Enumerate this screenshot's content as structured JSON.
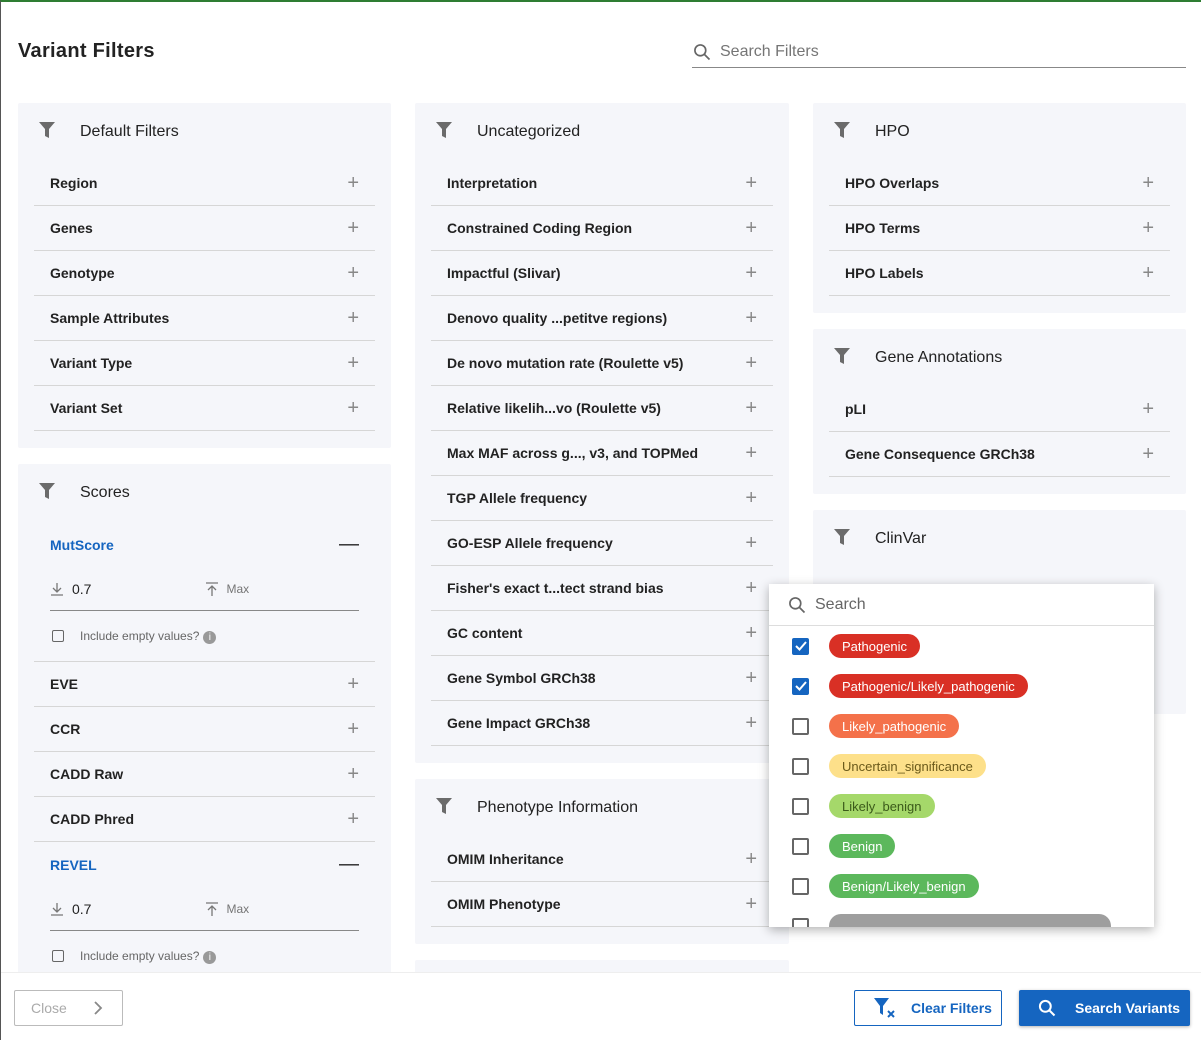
{
  "title": "Variant Filters",
  "search": {
    "placeholder": "Search Filters"
  },
  "colors": {
    "accent": "#1565c0",
    "panel_bg": "#f5f6fa",
    "top_border": "#2e7d32"
  },
  "panels": [
    {
      "title": "Default Filters",
      "rows": [
        {
          "label": "Region"
        },
        {
          "label": "Genes"
        },
        {
          "label": "Genotype"
        },
        {
          "label": "Sample Attributes"
        },
        {
          "label": "Variant Type"
        },
        {
          "label": "Variant Set"
        }
      ]
    },
    {
      "title": "Scores",
      "rows": [
        {
          "label": "MutScore",
          "open": true,
          "min": "0.7",
          "max_placeholder": "Max",
          "empty_label": "Include empty values?"
        },
        {
          "label": "EVE"
        },
        {
          "label": "CCR"
        },
        {
          "label": "CADD Raw"
        },
        {
          "label": "CADD Phred"
        },
        {
          "label": "REVEL",
          "open": true,
          "min": "0.7",
          "max_placeholder": "Max",
          "empty_label": "Include empty values?"
        }
      ]
    },
    {
      "title": "Uncategorized",
      "rows": [
        {
          "label": "Interpretation"
        },
        {
          "label": "Constrained Coding Region"
        },
        {
          "label": "Impactful (Slivar)"
        },
        {
          "label": "Denovo quality ...petitve regions)"
        },
        {
          "label": "De novo mutation rate (Roulette v5)"
        },
        {
          "label": "Relative likelih...vo (Roulette v5)"
        },
        {
          "label": "Max MAF across g..., v3, and TOPMed"
        },
        {
          "label": "TGP Allele frequency"
        },
        {
          "label": "GO-ESP Allele frequency"
        },
        {
          "label": "Fisher's exact t...tect strand bias"
        },
        {
          "label": "GC content"
        },
        {
          "label": "Gene Symbol GRCh38"
        },
        {
          "label": "Gene Impact GRCh38"
        }
      ]
    },
    {
      "title": "Phenotype Information",
      "rows": [
        {
          "label": "OMIM Inheritance"
        },
        {
          "label": "OMIM Phenotype"
        }
      ]
    },
    {
      "title": "",
      "rows": []
    },
    {
      "title": "HPO",
      "rows": [
        {
          "label": "HPO Overlaps"
        },
        {
          "label": "HPO Terms"
        },
        {
          "label": "HPO Labels"
        }
      ]
    },
    {
      "title": "Gene Annotations",
      "rows": [
        {
          "label": "pLI"
        },
        {
          "label": "Gene Consequence GRCh38"
        }
      ]
    },
    {
      "title": "ClinVar",
      "rows": []
    }
  ],
  "clinvar_popup": {
    "search_placeholder": "Search",
    "options": [
      {
        "label": "Pathogenic",
        "checked": true,
        "bg": "#d93025",
        "fg": "#ffffff"
      },
      {
        "label": "Pathogenic/Likely_pathogenic",
        "checked": true,
        "bg": "#d93025",
        "fg": "#ffffff"
      },
      {
        "label": "Likely_pathogenic",
        "checked": false,
        "bg": "#f4714a",
        "fg": "#ffffff"
      },
      {
        "label": "Uncertain_significance",
        "checked": false,
        "bg": "#fde08a",
        "fg": "#6b5a1a"
      },
      {
        "label": "Likely_benign",
        "checked": false,
        "bg": "#a5d86a",
        "fg": "#3b5a1a"
      },
      {
        "label": "Benign",
        "checked": false,
        "bg": "#5cb85c",
        "fg": "#ffffff"
      },
      {
        "label": "Benign/Likely_benign",
        "checked": false,
        "bg": "#5cb85c",
        "fg": "#ffffff"
      },
      {
        "label": "",
        "checked": false,
        "bg": "#9e9e9e",
        "fg": "#ffffff"
      }
    ]
  },
  "footer": {
    "close": "Close",
    "clear": "Clear Filters",
    "search": "Search Variants"
  }
}
